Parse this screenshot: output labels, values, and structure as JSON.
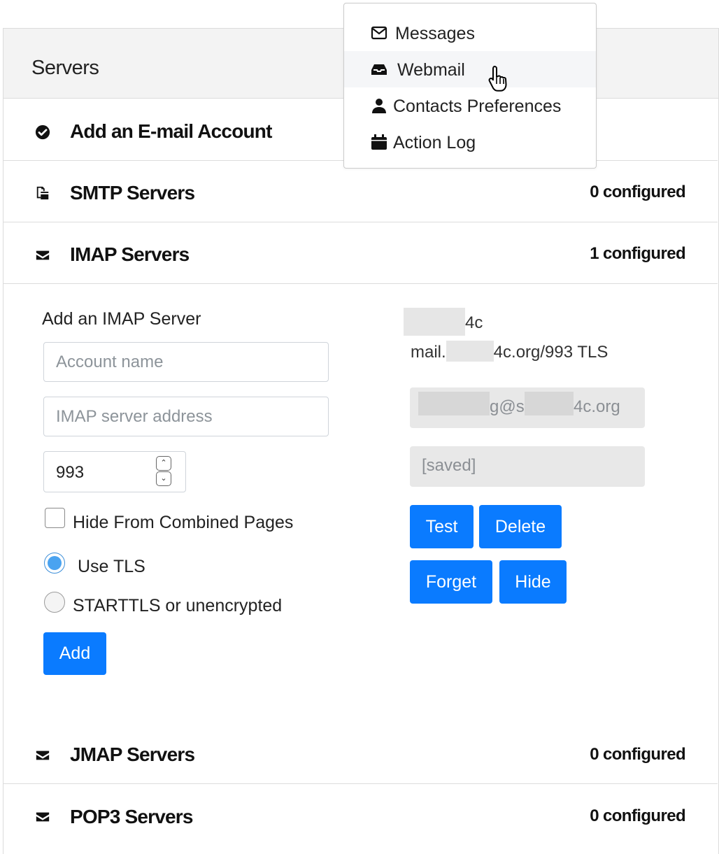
{
  "panel": {
    "title": "Servers",
    "sections": [
      {
        "label": "Add an E-mail Account",
        "icon": "check-circle-icon",
        "count": ""
      },
      {
        "label": "SMTP Servers",
        "icon": "file-export-icon",
        "count": "0 configured"
      },
      {
        "label": "IMAP Servers",
        "icon": "envelope-icon",
        "count": "1 configured"
      },
      {
        "label": "JMAP Servers",
        "icon": "envelope-icon",
        "count": "0 configured"
      },
      {
        "label": "POP3 Servers",
        "icon": "envelope-icon",
        "count": "0 configured"
      }
    ]
  },
  "imap_form": {
    "heading": "Add an IMAP Server",
    "account_name_placeholder": "Account name",
    "server_address_placeholder": "IMAP server address",
    "port_value": "993",
    "hide_combined_label": "Hide From Combined Pages",
    "hide_combined_checked": false,
    "tls_label": "Use TLS",
    "starttls_label": "STARTTLS or unencrypted",
    "selected_security": "Use TLS",
    "add_button": "Add"
  },
  "imap_account": {
    "name_visible": "4c",
    "host_prefix": "mail.",
    "host_suffix": "4c.org/993 TLS",
    "username_mid": "g@s",
    "username_suffix": "4c.org",
    "password_placeholder": "[saved]",
    "buttons": {
      "test": "Test",
      "delete": "Delete",
      "forget": "Forget",
      "hide": "Hide"
    }
  },
  "dropdown_menu": {
    "items": [
      {
        "label": "Messages",
        "icon": "envelope-outline-icon"
      },
      {
        "label": "Webmail",
        "icon": "inbox-icon",
        "hovered": true
      },
      {
        "label": "Contacts Preferences",
        "icon": "user-icon"
      },
      {
        "label": "Action Log",
        "icon": "calendar-icon"
      }
    ]
  },
  "colors": {
    "primary_button": "#0a7bff",
    "panel_header_bg": "#f3f3f3",
    "readonly_field_bg": "#e8e8e8",
    "radio_selected": "#4aa3f0"
  }
}
